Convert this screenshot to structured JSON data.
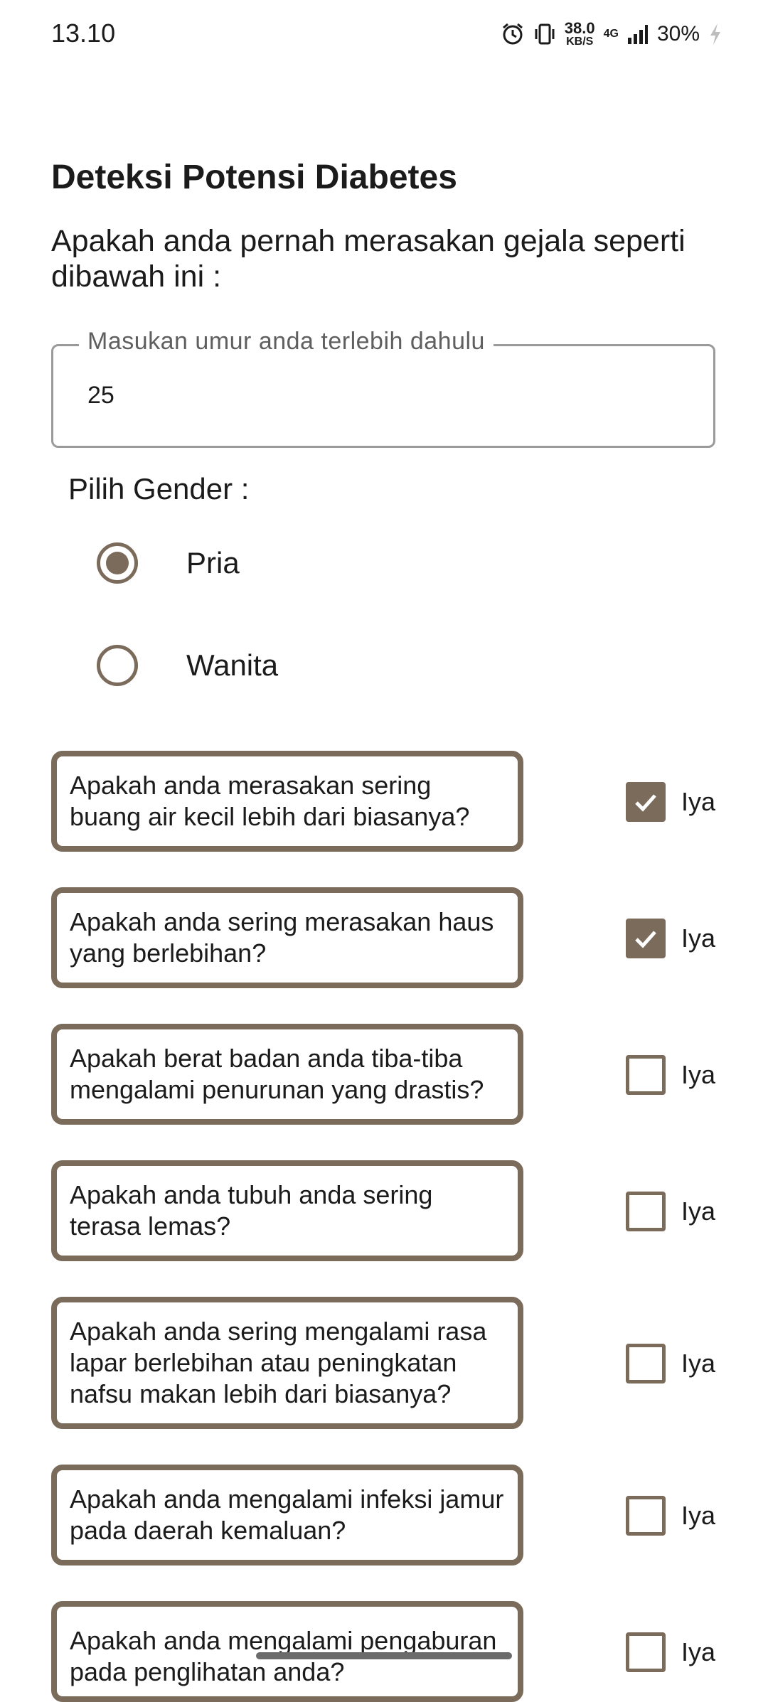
{
  "status_bar": {
    "time": "13.10",
    "speed_value": "38.0",
    "speed_unit": "KB/S",
    "network": "4G",
    "battery": "30%"
  },
  "title": "Deteksi Potensi Diabetes",
  "subtitle": "Apakah anda pernah merasakan gejala seperti dibawah ini :",
  "age_field": {
    "label": "Masukan umur anda terlebih dahulu",
    "value": "25"
  },
  "gender": {
    "label": "Pilih Gender :",
    "options": [
      {
        "label": "Pria",
        "selected": true
      },
      {
        "label": "Wanita",
        "selected": false
      }
    ]
  },
  "questions": [
    {
      "text": "Apakah anda merasakan sering buang air kecil lebih dari biasanya?",
      "answer_label": "Iya",
      "checked": true
    },
    {
      "text": "Apakah anda sering merasakan haus yang berlebihan?",
      "answer_label": "Iya",
      "checked": true
    },
    {
      "text": "Apakah berat badan anda tiba-tiba mengalami penurunan yang drastis?",
      "answer_label": "Iya",
      "checked": false
    },
    {
      "text": "Apakah anda tubuh anda sering terasa lemas?",
      "answer_label": "Iya",
      "checked": false
    },
    {
      "text": "Apakah anda sering mengalami rasa lapar berlebihan atau peningkatan nafsu makan lebih dari biasanya?",
      "answer_label": "Iya",
      "checked": false
    },
    {
      "text": "Apakah anda mengalami infeksi jamur pada daerah kemaluan?",
      "answer_label": "Iya",
      "checked": false
    },
    {
      "text": "Apakah anda mengalami pengaburan pada penglihatan anda?",
      "answer_label": "Iya",
      "checked": false
    }
  ],
  "colors": {
    "accent": "#7b6b5a",
    "outline": "#9a9a9a",
    "text": "#1b1b1b"
  }
}
